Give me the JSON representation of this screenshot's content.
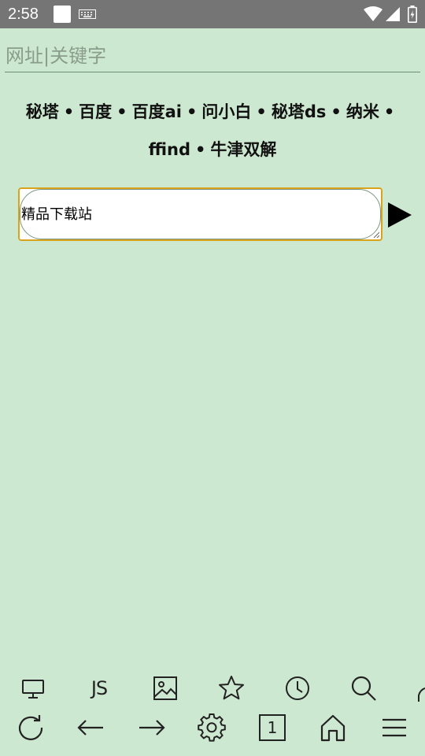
{
  "status_bar": {
    "time": "2:58",
    "icons": [
      "notification-square-icon",
      "keyboard-icon",
      "wifi-icon",
      "signal-icon",
      "battery-charging-icon"
    ]
  },
  "address_bar": {
    "placeholder": "网址|关键字",
    "value": ""
  },
  "quick_links": {
    "separator": "•",
    "items": [
      {
        "label": "秘塔"
      },
      {
        "label": "百度"
      },
      {
        "label": "百度ai"
      },
      {
        "label": "问小白"
      },
      {
        "label": "秘塔ds"
      },
      {
        "label": "纳米"
      },
      {
        "label": "ffind"
      },
      {
        "label": "牛津双解"
      }
    ]
  },
  "search_box": {
    "value": "精品下载站",
    "submit_icon": "play-icon"
  },
  "toolbar_top": {
    "js_label": "JS",
    "icons": [
      "desktop-icon",
      "js-icon",
      "image-icon",
      "star-icon",
      "clock-icon",
      "search-icon",
      "more-icon"
    ]
  },
  "toolbar_bottom": {
    "tab_count": "1",
    "icons": [
      "refresh-icon",
      "back-arrow-icon",
      "forward-arrow-icon",
      "gear-icon",
      "tabs-icon",
      "home-icon",
      "menu-icon"
    ]
  },
  "colors": {
    "background": "#cde8d0",
    "status_bar": "#757575",
    "focus_border": "#d9a21b"
  }
}
